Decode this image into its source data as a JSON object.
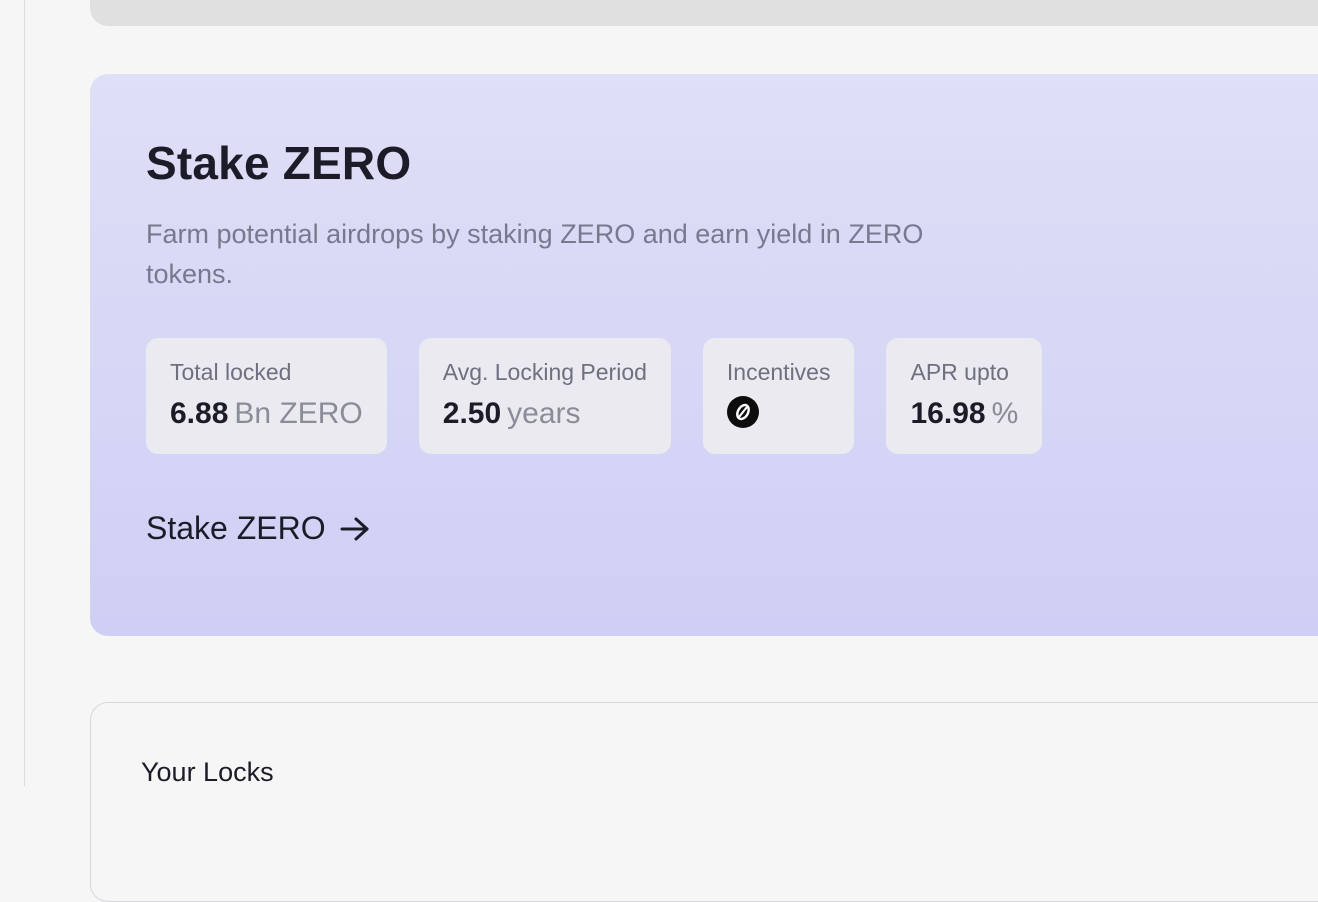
{
  "stake": {
    "title": "Stake ZERO",
    "description": "Farm potential airdrops by staking ZERO and earn yield in ZERO tokens.",
    "cta_label": "Stake ZERO"
  },
  "stats": {
    "total_locked": {
      "label": "Total locked",
      "value": "6.88",
      "unit": "Bn ZERO"
    },
    "avg_period": {
      "label": "Avg. Locking Period",
      "value": "2.50",
      "unit": "years"
    },
    "incentives": {
      "label": "Incentives",
      "icon": "zero-token-icon"
    },
    "apr": {
      "label": "APR upto",
      "value": "16.98",
      "unit": "%"
    }
  },
  "locks": {
    "title": "Your Locks"
  }
}
